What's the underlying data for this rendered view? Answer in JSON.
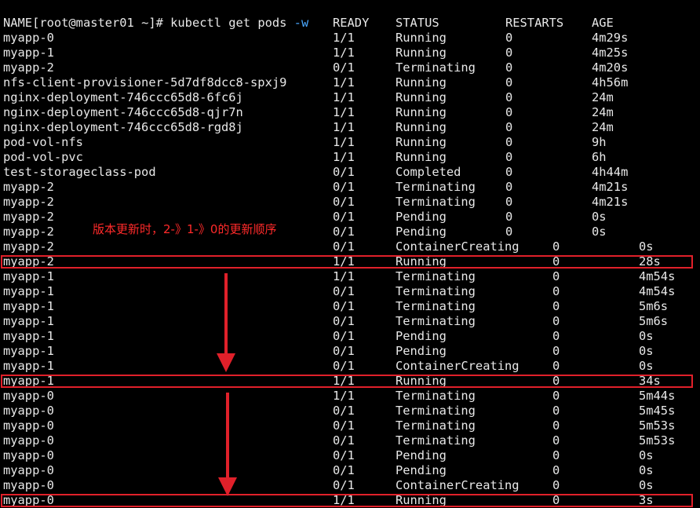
{
  "prompt": {
    "user_host": "[root@master01 ~]# ",
    "command": "kubectl get pods ",
    "flag": "-w"
  },
  "header": {
    "name": "NAME",
    "ready": "READY",
    "status": "STATUS",
    "restarts": "RESTARTS",
    "age": "AGE"
  },
  "rows": [
    {
      "name": "myapp-0",
      "ready": "1/1",
      "status": "Running",
      "restarts": "0",
      "age": "4m29s"
    },
    {
      "name": "myapp-1",
      "ready": "1/1",
      "status": "Running",
      "restarts": "0",
      "age": "4m25s"
    },
    {
      "name": "myapp-2",
      "ready": "0/1",
      "status": "Terminating",
      "restarts": "0",
      "age": "4m20s"
    },
    {
      "name": "nfs-client-provisioner-5d7df8dcc8-spxj9",
      "ready": "1/1",
      "status": "Running",
      "restarts": "0",
      "age": "4h56m"
    },
    {
      "name": "nginx-deployment-746ccc65d8-6fc6j",
      "ready": "1/1",
      "status": "Running",
      "restarts": "0",
      "age": "24m"
    },
    {
      "name": "nginx-deployment-746ccc65d8-qjr7n",
      "ready": "1/1",
      "status": "Running",
      "restarts": "0",
      "age": "24m"
    },
    {
      "name": "nginx-deployment-746ccc65d8-rgd8j",
      "ready": "1/1",
      "status": "Running",
      "restarts": "0",
      "age": "24m"
    },
    {
      "name": "pod-vol-nfs",
      "ready": "1/1",
      "status": "Running",
      "restarts": "0",
      "age": "9h"
    },
    {
      "name": "pod-vol-pvc",
      "ready": "1/1",
      "status": "Running",
      "restarts": "0",
      "age": "6h"
    },
    {
      "name": "test-storageclass-pod",
      "ready": "0/1",
      "status": "Completed",
      "restarts": "0",
      "age": "4h44m"
    },
    {
      "name": "myapp-2",
      "ready": "0/1",
      "status": "Terminating",
      "restarts": "0",
      "age": "4m21s"
    },
    {
      "name": "myapp-2",
      "ready": "0/1",
      "status": "Terminating",
      "restarts": "0",
      "age": "4m21s"
    },
    {
      "name": "myapp-2",
      "ready": "0/1",
      "status": "Pending",
      "restarts": "0",
      "age": "0s"
    },
    {
      "name": "myapp-2",
      "ready": "0/1",
      "status": "Pending",
      "restarts": "0",
      "age": "0s"
    },
    {
      "name": "myapp-2",
      "ready": "0/1",
      "status": "ContainerCreating",
      "restarts": "0",
      "age": "0s",
      "shifted": true
    },
    {
      "name": "myapp-2",
      "ready": "1/1",
      "status": "Running",
      "restarts": "0",
      "age": "28s",
      "shifted": true,
      "highlight": true
    },
    {
      "name": "myapp-1",
      "ready": "1/1",
      "status": "Terminating",
      "restarts": "0",
      "age": "4m54s",
      "shifted": true
    },
    {
      "name": "myapp-1",
      "ready": "0/1",
      "status": "Terminating",
      "restarts": "0",
      "age": "4m54s",
      "shifted": true
    },
    {
      "name": "myapp-1",
      "ready": "0/1",
      "status": "Terminating",
      "restarts": "0",
      "age": "5m6s",
      "shifted": true
    },
    {
      "name": "myapp-1",
      "ready": "0/1",
      "status": "Terminating",
      "restarts": "0",
      "age": "5m6s",
      "shifted": true
    },
    {
      "name": "myapp-1",
      "ready": "0/1",
      "status": "Pending",
      "restarts": "0",
      "age": "0s",
      "shifted": true
    },
    {
      "name": "myapp-1",
      "ready": "0/1",
      "status": "Pending",
      "restarts": "0",
      "age": "0s",
      "shifted": true
    },
    {
      "name": "myapp-1",
      "ready": "0/1",
      "status": "ContainerCreating",
      "restarts": "0",
      "age": "0s",
      "shifted": true
    },
    {
      "name": "myapp-1",
      "ready": "1/1",
      "status": "Running",
      "restarts": "0",
      "age": "34s",
      "shifted": true,
      "highlight": true
    },
    {
      "name": "myapp-0",
      "ready": "1/1",
      "status": "Terminating",
      "restarts": "0",
      "age": "5m44s",
      "shifted": true
    },
    {
      "name": "myapp-0",
      "ready": "0/1",
      "status": "Terminating",
      "restarts": "0",
      "age": "5m45s",
      "shifted": true
    },
    {
      "name": "myapp-0",
      "ready": "0/1",
      "status": "Terminating",
      "restarts": "0",
      "age": "5m53s",
      "shifted": true
    },
    {
      "name": "myapp-0",
      "ready": "0/1",
      "status": "Terminating",
      "restarts": "0",
      "age": "5m53s",
      "shifted": true
    },
    {
      "name": "myapp-0",
      "ready": "0/1",
      "status": "Pending",
      "restarts": "0",
      "age": "0s",
      "shifted": true
    },
    {
      "name": "myapp-0",
      "ready": "0/1",
      "status": "Pending",
      "restarts": "0",
      "age": "0s",
      "shifted": true
    },
    {
      "name": "myapp-0",
      "ready": "0/1",
      "status": "ContainerCreating",
      "restarts": "0",
      "age": "0s",
      "shifted": true
    },
    {
      "name": "myapp-0",
      "ready": "1/1",
      "status": "Running",
      "restarts": "0",
      "age": "3s",
      "shifted": true,
      "highlight": true
    }
  ],
  "annotation": {
    "text": "版本更新时，2-》1-》0的更新顺序"
  },
  "colors": {
    "background": "#000000",
    "text": "#e8e8e8",
    "flag": "#4aa8ff",
    "highlight": "#e0202a",
    "annotation": "#ff2a2a"
  }
}
